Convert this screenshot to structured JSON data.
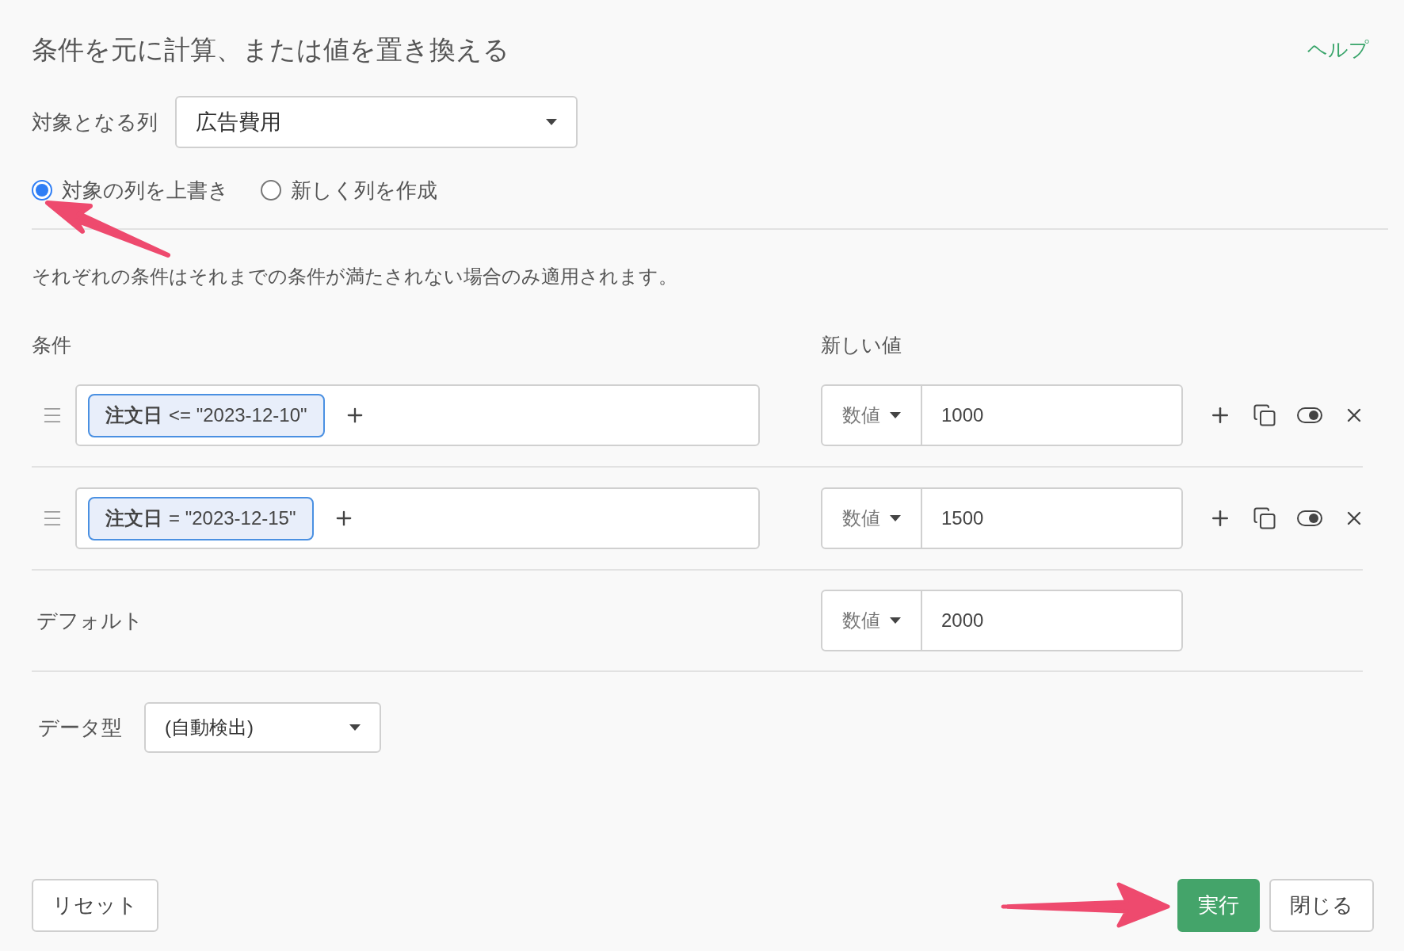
{
  "header": {
    "title": "条件を元に計算、または値を置き換える",
    "help_link": "ヘルプ"
  },
  "target_column": {
    "label": "対象となる列",
    "value": "広告費用"
  },
  "mode_options": [
    {
      "label": "対象の列を上書き",
      "selected": true
    },
    {
      "label": "新しく列を作成",
      "selected": false
    }
  ],
  "note": "それぞれの条件はそれまでの条件が満たされない場合のみ適用されます。",
  "conditions": {
    "header": "条件",
    "value_header": "新しい値",
    "rows": [
      {
        "field": "注文日",
        "expression": "<= \"2023-12-10\"",
        "type": "数値",
        "value": "1000",
        "enabled": true
      },
      {
        "field": "注文日",
        "expression": "= \"2023-12-15\"",
        "type": "数値",
        "value": "1500",
        "enabled": true
      }
    ]
  },
  "default": {
    "label": "デフォルト",
    "type": "数値",
    "value": "2000"
  },
  "data_type": {
    "label": "データ型",
    "value": "(自動検出)"
  },
  "footer": {
    "left": [
      {
        "label": "リセット",
        "kind": "secondary"
      }
    ],
    "right": [
      {
        "label": "実行",
        "kind": "primary"
      },
      {
        "label": "閉じる",
        "kind": "secondary"
      }
    ]
  }
}
